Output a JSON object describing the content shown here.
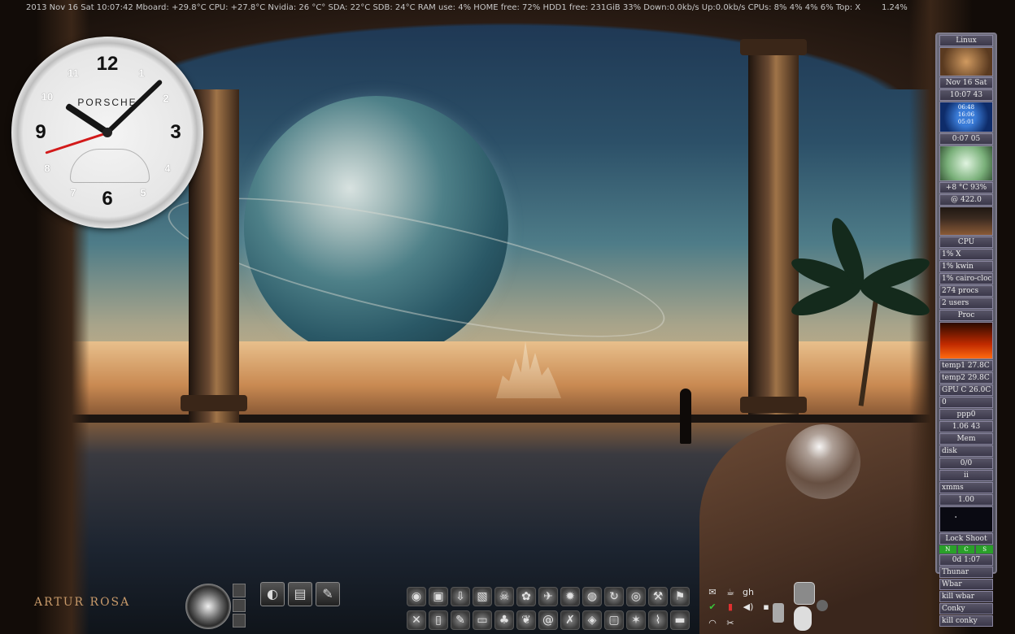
{
  "topbar": {
    "stats": "2013 Nov 16 Sat 10:07:42 Mboard:  +29.8°C CPU: +27.8°C Nvidia: 26 °C° SDA:  22°C SDB:  24°C  RAM use: 4%  HOME free: 72%  HDD1 free: 231GiB 33% Down:0.0kb/s  Up:0.0kb/s  CPUs: 8% 4% 4% 6% Top: X",
    "load": "1.24%"
  },
  "clock": {
    "brand": "PORSCHE",
    "numerals": {
      "n12": "12",
      "n3": "3",
      "n6": "6",
      "n9": "9",
      "n1": "1",
      "n2": "2",
      "n4": "4",
      "n5": "5",
      "n7": "7",
      "n8": "8",
      "n10": "10",
      "n11": "11"
    },
    "time": {
      "hour": 10,
      "minute": 7,
      "second": 42
    }
  },
  "sidebar": {
    "os": "Linux",
    "date": "Nov 16 Sat",
    "time": "10:07 43",
    "blue_widget": [
      "06:48",
      "16:06",
      "05:01"
    ],
    "uptime": "0:07 05",
    "temp": "+8 °C  93%",
    "freq": "@ 422.0",
    "cpu_title": "CPU",
    "cpu_procs": [
      "1% X",
      "1% kwin",
      "1% cairo-cloc"
    ],
    "procs_info": "274 procs",
    "users_info": "2 users",
    "proc_title": "Proc",
    "temps": [
      "temp1   27.8C",
      "temp2   29.8C",
      "GPU C   26.0C"
    ],
    "net_zero": "0",
    "ppp": "ppp0",
    "net_stat": "1.06  43",
    "mem_title": "Mem",
    "disk": "disk",
    "disk_val": "0/0",
    "disk_b": "ii",
    "xmms": "xmms",
    "xmms_val": "1.00",
    "lock_label": "Lock  Shoot",
    "lock_buttons": [
      "N",
      "C",
      "S"
    ],
    "counter": "0d  1:07",
    "launchers": [
      "Thunar",
      "Wbar",
      "kill wbar",
      "Conky",
      "kill conky"
    ]
  },
  "signature": "ARTUR ROSA",
  "dock": {
    "quick": [
      "quick-launch-1",
      "quick-launch-2",
      "quick-launch-3"
    ],
    "row1": [
      "disc-icon",
      "package-icon",
      "install-icon",
      "pdf-icon",
      "skull-icon",
      "gimp-icon",
      "plane-icon",
      "gear-icon",
      "globe-icon",
      "reload-icon",
      "cd-icon",
      "tools-icon",
      "flag-icon"
    ],
    "row2": [
      "wrench-icon",
      "phone-icon",
      "pen-icon",
      "monitor-icon",
      "penguin-icon",
      "leaf-icon",
      "swirl-icon",
      "crossed-icon",
      "chat-icon",
      "terminal-icon",
      "star-icon",
      "network-icon",
      "folder-icon"
    ],
    "tray_row1": [
      "mail-icon",
      "notes-icon",
      "gh"
    ],
    "tray_row2": [
      "check-icon",
      "battery-icon",
      "volume-icon",
      "dot-icon"
    ],
    "tray_row3": [
      "wifi-icon",
      "scissors-icon"
    ]
  }
}
